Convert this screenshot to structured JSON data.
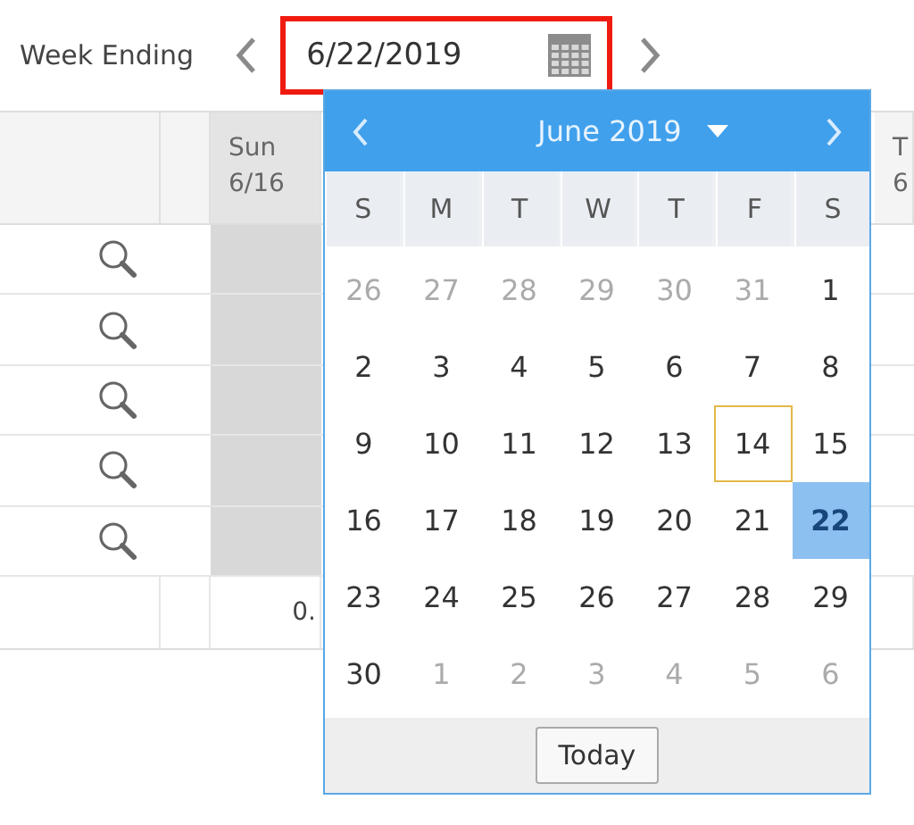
{
  "toolbar": {
    "label": "Week Ending"
  },
  "date_field": {
    "value": "6/22/2019",
    "highlighted": true
  },
  "grid": {
    "columns": [
      {
        "lines": [
          "Sun",
          "6/16"
        ],
        "shaded": true
      },
      {
        "lines": [
          "T",
          "6"
        ],
        "shaded": false
      }
    ],
    "rows": [
      {
        "lookup": true
      },
      {
        "lookup": true
      },
      {
        "lookup": true
      },
      {
        "lookup": true
      },
      {
        "lookup": true
      }
    ],
    "totals": {
      "value": "0."
    }
  },
  "calendar": {
    "month": "June 2019",
    "weekdays": [
      "S",
      "M",
      "T",
      "W",
      "T",
      "F",
      "S"
    ],
    "days": [
      {
        "day": "26",
        "outside": true,
        "selected": false,
        "today": false
      },
      {
        "day": "27",
        "outside": true,
        "selected": false,
        "today": false
      },
      {
        "day": "28",
        "outside": true,
        "selected": false,
        "today": false
      },
      {
        "day": "29",
        "outside": true,
        "selected": false,
        "today": false
      },
      {
        "day": "30",
        "outside": true,
        "selected": false,
        "today": false
      },
      {
        "day": "31",
        "outside": true,
        "selected": false,
        "today": false
      },
      {
        "day": "1",
        "outside": false,
        "selected": false,
        "today": false
      },
      {
        "day": "2",
        "outside": false,
        "selected": false,
        "today": false
      },
      {
        "day": "3",
        "outside": false,
        "selected": false,
        "today": false
      },
      {
        "day": "4",
        "outside": false,
        "selected": false,
        "today": false
      },
      {
        "day": "5",
        "outside": false,
        "selected": false,
        "today": false
      },
      {
        "day": "6",
        "outside": false,
        "selected": false,
        "today": false
      },
      {
        "day": "7",
        "outside": false,
        "selected": false,
        "today": false
      },
      {
        "day": "8",
        "outside": false,
        "selected": false,
        "today": false
      },
      {
        "day": "9",
        "outside": false,
        "selected": false,
        "today": false
      },
      {
        "day": "10",
        "outside": false,
        "selected": false,
        "today": false
      },
      {
        "day": "11",
        "outside": false,
        "selected": false,
        "today": false
      },
      {
        "day": "12",
        "outside": false,
        "selected": false,
        "today": false
      },
      {
        "day": "13",
        "outside": false,
        "selected": false,
        "today": false
      },
      {
        "day": "14",
        "outside": false,
        "selected": false,
        "today": true
      },
      {
        "day": "15",
        "outside": false,
        "selected": false,
        "today": false
      },
      {
        "day": "16",
        "outside": false,
        "selected": false,
        "today": false
      },
      {
        "day": "17",
        "outside": false,
        "selected": false,
        "today": false
      },
      {
        "day": "18",
        "outside": false,
        "selected": false,
        "today": false
      },
      {
        "day": "19",
        "outside": false,
        "selected": false,
        "today": false
      },
      {
        "day": "20",
        "outside": false,
        "selected": false,
        "today": false
      },
      {
        "day": "21",
        "outside": false,
        "selected": false,
        "today": false
      },
      {
        "day": "22",
        "outside": false,
        "selected": true,
        "today": false
      },
      {
        "day": "23",
        "outside": false,
        "selected": false,
        "today": false
      },
      {
        "day": "24",
        "outside": false,
        "selected": false,
        "today": false
      },
      {
        "day": "25",
        "outside": false,
        "selected": false,
        "today": false
      },
      {
        "day": "26",
        "outside": false,
        "selected": false,
        "today": false
      },
      {
        "day": "27",
        "outside": false,
        "selected": false,
        "today": false
      },
      {
        "day": "28",
        "outside": false,
        "selected": false,
        "today": false
      },
      {
        "day": "29",
        "outside": false,
        "selected": false,
        "today": false
      },
      {
        "day": "30",
        "outside": false,
        "selected": false,
        "today": false
      },
      {
        "day": "1",
        "outside": true,
        "selected": false,
        "today": false
      },
      {
        "day": "2",
        "outside": true,
        "selected": false,
        "today": false
      },
      {
        "day": "3",
        "outside": true,
        "selected": false,
        "today": false
      },
      {
        "day": "4",
        "outside": true,
        "selected": false,
        "today": false
      },
      {
        "day": "5",
        "outside": true,
        "selected": false,
        "today": false
      },
      {
        "day": "6",
        "outside": true,
        "selected": false,
        "today": false
      }
    ],
    "today_button": "Today"
  }
}
